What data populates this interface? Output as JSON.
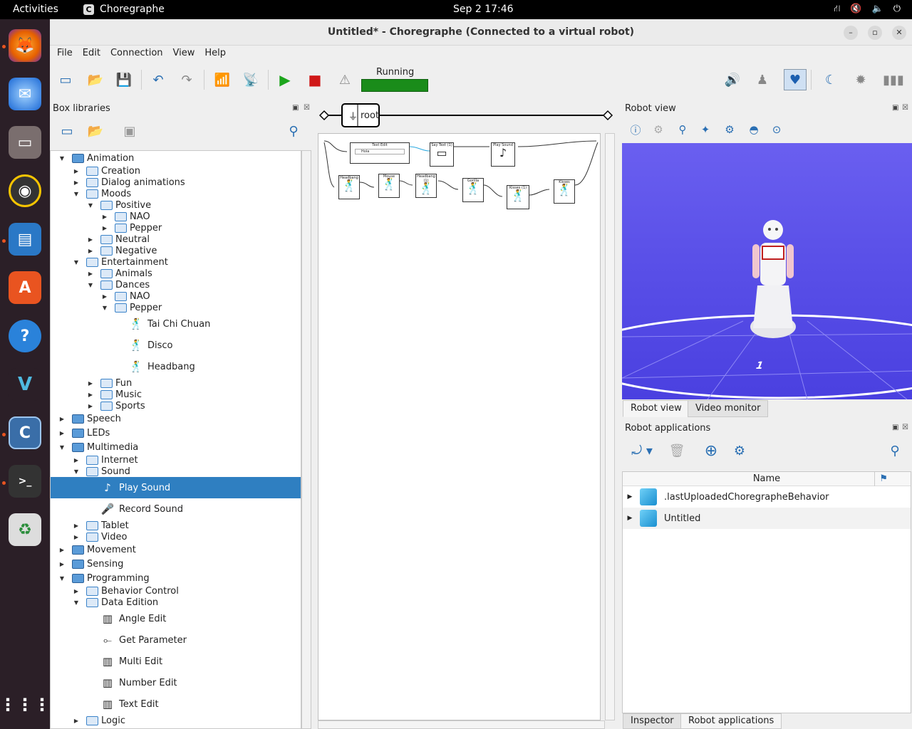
{
  "topbar": {
    "activities": "Activities",
    "app": "Choregraphe",
    "clock": "Sep 2  17:46"
  },
  "window": {
    "title": "Untitled* - Choregraphe (Connected to a virtual robot)"
  },
  "menu": [
    "File",
    "Edit",
    "Connection",
    "View",
    "Help"
  ],
  "status": {
    "running": "Running"
  },
  "box_libraries": {
    "title": "Box libraries",
    "tree": [
      {
        "label": "Animation",
        "type": "lib",
        "depth": 0,
        "arrow": "down"
      },
      {
        "label": "Creation",
        "type": "folder",
        "depth": 1,
        "arrow": "right"
      },
      {
        "label": "Dialog animations",
        "type": "folder",
        "depth": 1,
        "arrow": "right"
      },
      {
        "label": "Moods",
        "type": "folder",
        "depth": 1,
        "arrow": "down"
      },
      {
        "label": "Positive",
        "type": "folder",
        "depth": 2,
        "arrow": "down"
      },
      {
        "label": "NAO",
        "type": "folder",
        "depth": 3,
        "arrow": "right"
      },
      {
        "label": "Pepper",
        "type": "folder",
        "depth": 3,
        "arrow": "right"
      },
      {
        "label": "Neutral",
        "type": "folder",
        "depth": 2,
        "arrow": "right"
      },
      {
        "label": "Negative",
        "type": "folder",
        "depth": 2,
        "arrow": "right"
      },
      {
        "label": "Entertainment",
        "type": "folder",
        "depth": 1,
        "arrow": "down"
      },
      {
        "label": "Animals",
        "type": "folder",
        "depth": 2,
        "arrow": "right"
      },
      {
        "label": "Dances",
        "type": "folder",
        "depth": 2,
        "arrow": "down"
      },
      {
        "label": "NAO",
        "type": "folder",
        "depth": 3,
        "arrow": "right"
      },
      {
        "label": "Pepper",
        "type": "folder",
        "depth": 3,
        "arrow": "down"
      },
      {
        "label": "Tai Chi Chuan",
        "type": "box",
        "depth": 4,
        "icon": "dancer-icon"
      },
      {
        "label": "Disco",
        "type": "box",
        "depth": 4,
        "icon": "dancer-icon"
      },
      {
        "label": "Headbang",
        "type": "box",
        "depth": 4,
        "icon": "dancer-icon"
      },
      {
        "label": "Fun",
        "type": "folder",
        "depth": 2,
        "arrow": "right"
      },
      {
        "label": "Music",
        "type": "folder",
        "depth": 2,
        "arrow": "right"
      },
      {
        "label": "Sports",
        "type": "folder",
        "depth": 2,
        "arrow": "right"
      },
      {
        "label": "Speech",
        "type": "lib",
        "depth": 0,
        "arrow": "right"
      },
      {
        "label": "LEDs",
        "type": "lib",
        "depth": 0,
        "arrow": "right"
      },
      {
        "label": "Multimedia",
        "type": "lib",
        "depth": 0,
        "arrow": "down"
      },
      {
        "label": "Internet",
        "type": "folder",
        "depth": 1,
        "arrow": "right"
      },
      {
        "label": "Sound",
        "type": "folder",
        "depth": 1,
        "arrow": "down"
      },
      {
        "label": "Play Sound",
        "type": "box",
        "depth": 2,
        "icon": "music-note-icon",
        "selected": true
      },
      {
        "label": "Record Sound",
        "type": "box",
        "depth": 2,
        "icon": "microphone-icon"
      },
      {
        "label": "Tablet",
        "type": "folder",
        "depth": 1,
        "arrow": "right"
      },
      {
        "label": "Video",
        "type": "folder",
        "depth": 1,
        "arrow": "right"
      },
      {
        "label": "Movement",
        "type": "lib",
        "depth": 0,
        "arrow": "right"
      },
      {
        "label": "Sensing",
        "type": "lib",
        "depth": 0,
        "arrow": "right"
      },
      {
        "label": "Programming",
        "type": "lib",
        "depth": 0,
        "arrow": "down"
      },
      {
        "label": "Behavior Control",
        "type": "folder",
        "depth": 1,
        "arrow": "right"
      },
      {
        "label": "Data Edition",
        "type": "folder",
        "depth": 1,
        "arrow": "down"
      },
      {
        "label": "Angle Edit",
        "type": "box",
        "depth": 2,
        "icon": "bars-icon"
      },
      {
        "label": "Get Parameter",
        "type": "box",
        "depth": 2,
        "icon": "connector-icon"
      },
      {
        "label": "Multi Edit",
        "type": "box",
        "depth": 2,
        "icon": "bars-icon"
      },
      {
        "label": "Number Edit",
        "type": "box",
        "depth": 2,
        "icon": "bars-icon"
      },
      {
        "label": "Text Edit",
        "type": "box",
        "depth": 2,
        "icon": "bars-icon"
      },
      {
        "label": "Logic",
        "type": "folder",
        "depth": 1,
        "arrow": "right"
      }
    ]
  },
  "flow": {
    "root_label": "root",
    "boxes": [
      {
        "label": "Text Edit",
        "value": "Hola"
      },
      {
        "label": "Say Text (1)"
      },
      {
        "label": "Play Sound"
      },
      {
        "label": "Headbang"
      },
      {
        "label": "Mouse"
      },
      {
        "label": "Headbang (1)"
      },
      {
        "label": "Gorilla"
      },
      {
        "label": "Kisses (1)"
      },
      {
        "label": "Kisses"
      }
    ]
  },
  "robot_view": {
    "title": "Robot view",
    "tabs": [
      "Robot view",
      "Video monitor"
    ],
    "floor_label": "1"
  },
  "robot_apps": {
    "title": "Robot applications",
    "column": "Name",
    "rows": [
      ".lastUploadedChoregrapheBehavior",
      "Untitled"
    ],
    "bottom_tabs": [
      "Inspector",
      "Robot applications"
    ]
  },
  "colors": {
    "accent": "#2f7fc1",
    "running": "#1a8c1a",
    "scene": "#5a50e8"
  }
}
